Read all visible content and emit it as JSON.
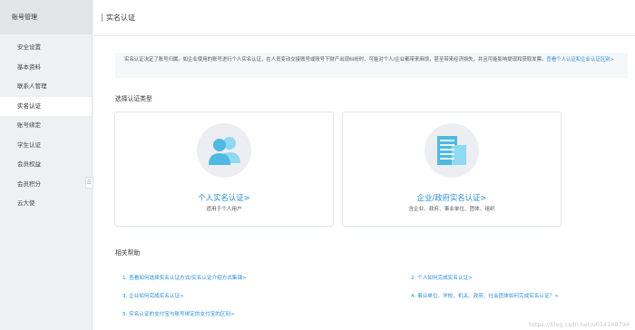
{
  "sidebar": {
    "header": "账号管理",
    "items": [
      {
        "label": "安全设置",
        "active": false
      },
      {
        "label": "基本资料",
        "active": false
      },
      {
        "label": "联系人管理",
        "active": false
      },
      {
        "label": "实名认证",
        "active": true
      },
      {
        "label": "账号绑定",
        "active": false
      },
      {
        "label": "学生认证",
        "active": false
      },
      {
        "label": "会员权益",
        "active": false
      },
      {
        "label": "会员积分",
        "active": false
      },
      {
        "label": "云大使",
        "active": false
      }
    ],
    "collapse_icon": "☰"
  },
  "main": {
    "title": "实名认证",
    "notice": {
      "text": "实名认证决定了账号归属。如企业使用的账号进行个人实名认证，在人员变动交接账号或账号下财产出现纠纷时，可能对个人/企业都带来麻烦，甚至带来经济损失，并且可能影响提现和获取发票。",
      "link": "查看个人认证和企业认证区别>"
    },
    "type_section_title": "选择认证类型",
    "cards": [
      {
        "title": "个人实名认证>",
        "desc": "适用于个人用户",
        "icon": "person-icon"
      },
      {
        "title": "企业/政府实名认证>",
        "desc": "含企业、政府、事业单位、团体、组织",
        "icon": "building-icon"
      }
    ],
    "help": {
      "title": "相关帮助",
      "links": [
        "1. 查看如何选择实名认证方式/实名认证介绍方式集锦>",
        "2. 个人如何完成实名认证>",
        "3. 企业如何完成实名认证>",
        "4. 事业单位、学校、机关、政府、社会团体如何完成实名认证？>",
        "5. 实名认证的支付宝与账号绑定的支付宝的区别>"
      ]
    }
  },
  "colors": {
    "accent": "#2a8dd4",
    "sidebar_bg": "#eef0f2",
    "icon_blue": "#5bc2e7"
  },
  "watermark": "https://blog.csdn.net/u014148794"
}
